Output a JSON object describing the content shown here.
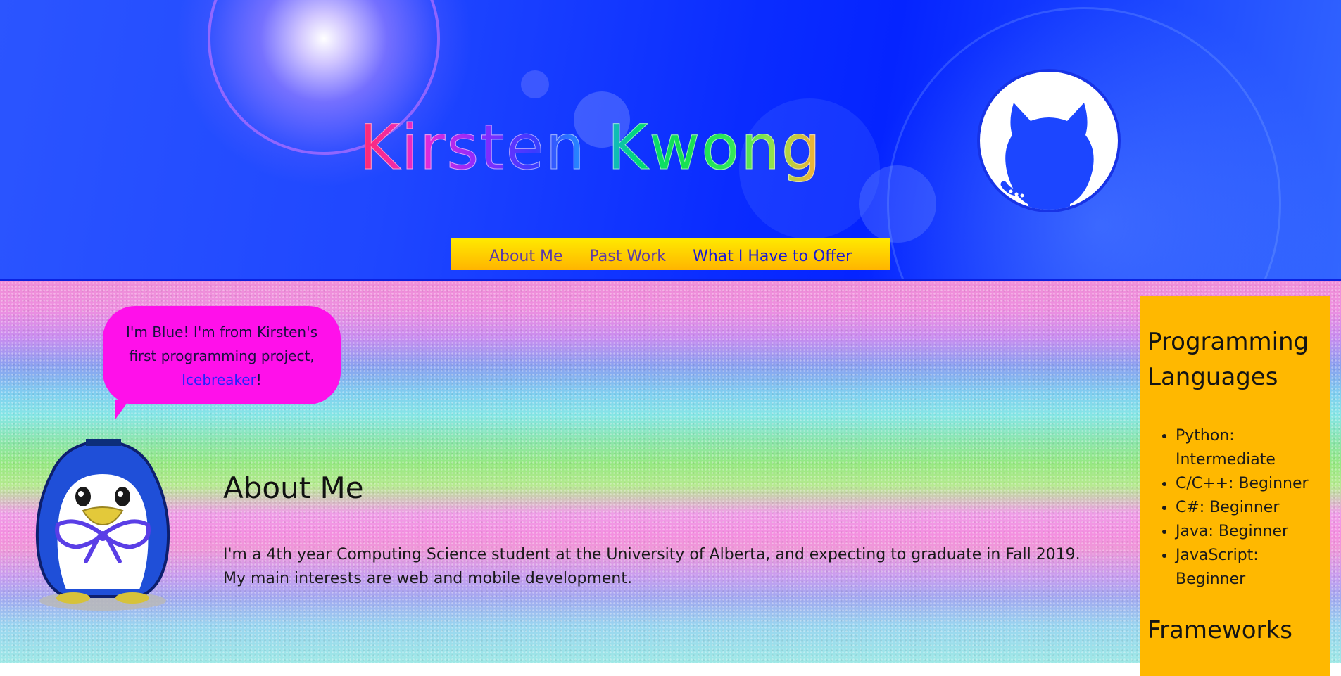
{
  "header": {
    "title": "Kirsten Kwong",
    "github_icon": "github-octocat-icon"
  },
  "nav": {
    "items": [
      {
        "label": "About Me"
      },
      {
        "label": "Past Work"
      },
      {
        "label": "What I Have to Offer"
      }
    ]
  },
  "mascot": {
    "speech_prefix": "I'm Blue! I'm from Kirsten's first programming project, ",
    "speech_link": "Icebreaker",
    "speech_suffix": "!",
    "image": "blue-penguin-mascot"
  },
  "about": {
    "heading": "About Me",
    "body": "I'm a 4th year Computing Science student at the University of Alberta, and expecting to graduate in Fall 2019. My main interests are web and mobile development."
  },
  "sidebar": {
    "languages_heading": "Programming Languages",
    "languages": [
      "Python: Intermediate",
      "C/C++: Beginner",
      "C#: Beginner",
      "Java: Beginner",
      "JavaScript: Beginner"
    ],
    "frameworks_heading": "Frameworks"
  },
  "colors": {
    "header_blue": "#1f47ff",
    "nav_yellow": "#ffd200",
    "bubble_magenta": "#ff10ea",
    "sidebar_orange": "#ffb800",
    "link_blue": "#2222ff"
  }
}
